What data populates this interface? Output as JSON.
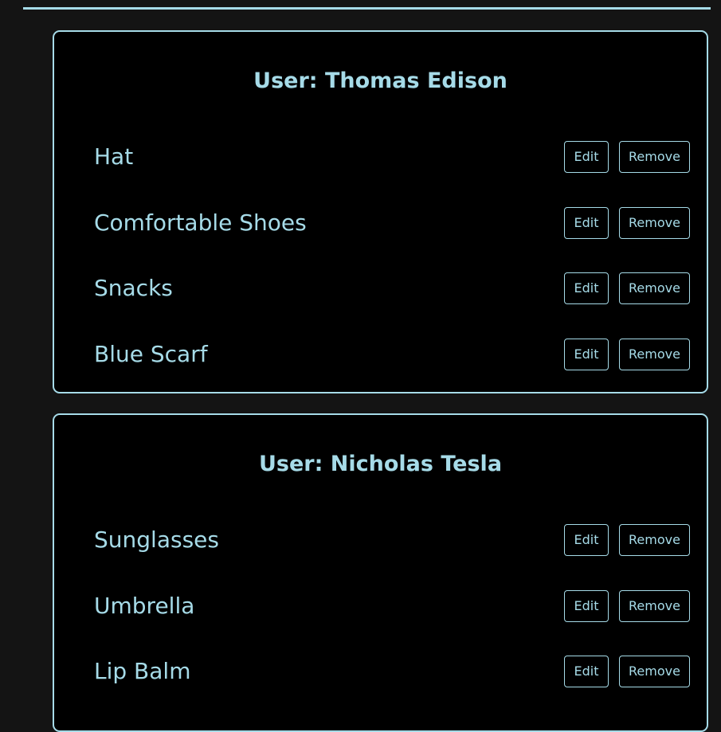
{
  "colors": {
    "accent": "#a6dbe8",
    "background": "#141414",
    "card": "#000000"
  },
  "users": [
    {
      "title": "User: Thomas Edison",
      "items": [
        {
          "name": "Hat",
          "edit_label": "Edit",
          "remove_label": "Remove"
        },
        {
          "name": "Comfortable Shoes",
          "edit_label": "Edit",
          "remove_label": "Remove"
        },
        {
          "name": "Snacks",
          "edit_label": "Edit",
          "remove_label": "Remove"
        },
        {
          "name": "Blue Scarf",
          "edit_label": "Edit",
          "remove_label": "Remove"
        }
      ]
    },
    {
      "title": "User: Nicholas Tesla",
      "items": [
        {
          "name": "Sunglasses",
          "edit_label": "Edit",
          "remove_label": "Remove"
        },
        {
          "name": "Umbrella",
          "edit_label": "Edit",
          "remove_label": "Remove"
        },
        {
          "name": "Lip Balm",
          "edit_label": "Edit",
          "remove_label": "Remove"
        }
      ]
    }
  ]
}
